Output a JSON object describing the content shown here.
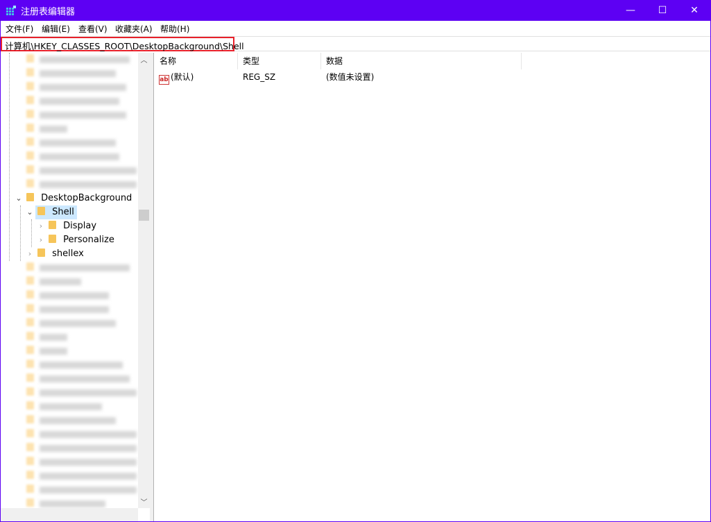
{
  "window": {
    "title": "注册表编辑器",
    "accent": "#5d00f3",
    "controls": {
      "minimize": "—",
      "maximize": "☐",
      "close": "✕"
    }
  },
  "menu": [
    "文件(F)",
    "编辑(E)",
    "查看(V)",
    "收藏夹(A)",
    "帮助(H)"
  ],
  "address": {
    "path": "计算机\\HKEY_CLASSES_ROOT\\DesktopBackground\\Shell",
    "highlight_color": "#e8202a"
  },
  "tree": {
    "blurred_before": 10,
    "nodes": [
      {
        "label": "DesktopBackground",
        "level": 1,
        "expanded": true
      },
      {
        "label": "Shell",
        "level": 2,
        "expanded": true,
        "selected": true
      },
      {
        "label": "Display",
        "level": 3,
        "expanded": false
      },
      {
        "label": "Personalize",
        "level": 3,
        "expanded": false
      },
      {
        "label": "shellex",
        "level": 2,
        "expanded": false
      }
    ],
    "blurred_after": 18
  },
  "list": {
    "columns": [
      "名称",
      "类型",
      "数据"
    ],
    "rows": [
      {
        "name": "(默认)",
        "type": "REG_SZ",
        "data": "(数值未设置)",
        "icon": "string-value-icon"
      }
    ]
  }
}
